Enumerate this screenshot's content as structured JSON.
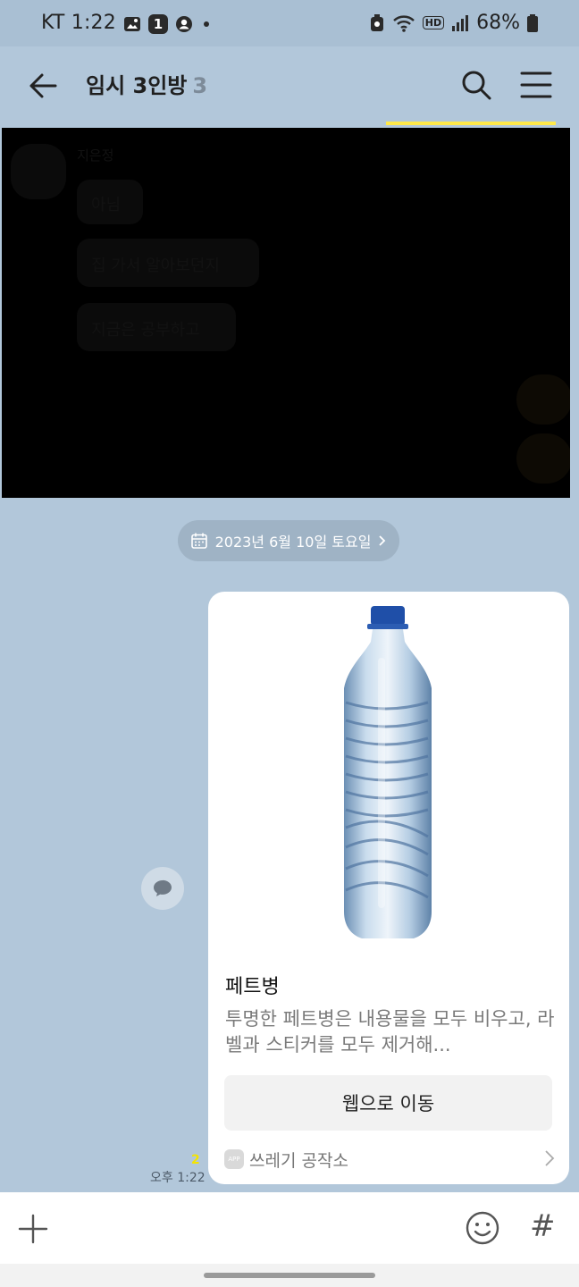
{
  "status_bar": {
    "carrier_time": "KT 1:22",
    "notification_count": "1",
    "hd_label": "HD",
    "battery": "68%"
  },
  "header": {
    "title": "임시 3인방",
    "member_count": "3"
  },
  "hidden_messages": {
    "sender": "지은정",
    "messages": [
      "아님",
      "집 가서 알아보던지",
      "지금은 공부하고"
    ]
  },
  "date_divider": {
    "label": "2023년 6월 10일 토요일"
  },
  "message": {
    "unread_count": "2",
    "time": "오후 1:22"
  },
  "card": {
    "title": "페트병",
    "description": "투명한 페트병은 내용물을 모두 비우고, 라벨과 스티커를 모두 제거해...",
    "button_label": "웹으로 이동",
    "app_badge": "APP",
    "source": "쓰레기 공작소"
  },
  "icons": {
    "back": "arrow-left-icon",
    "search": "search-icon",
    "menu": "hamburger-menu-icon",
    "reply": "speech-bubble-icon",
    "plus": "plus-icon",
    "emoji": "emoji-icon",
    "hash": "#"
  },
  "colors": {
    "chat_background": "#b2c7da",
    "accent_yellow": "#ffe94a"
  }
}
